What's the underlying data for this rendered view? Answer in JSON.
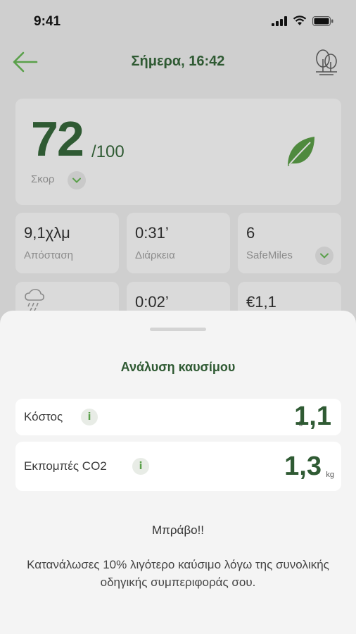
{
  "status_bar": {
    "time": "9:41"
  },
  "header": {
    "title": "Σήμερα, 16:42"
  },
  "score": {
    "value": "72",
    "total": "/100",
    "label": "Σκορ"
  },
  "stats": [
    {
      "value": "9,1χλμ",
      "label": "Απόσταση"
    },
    {
      "value": "0:31’",
      "label": "Διάρκεια"
    },
    {
      "value": "6",
      "label": "SafeMiles"
    },
    {
      "value": "0:02’"
    },
    {
      "value": "€1,1"
    }
  ],
  "sheet": {
    "title": "Ανάλυση καυσίμου",
    "rows": [
      {
        "label": "Κόστος",
        "prefix": "€",
        "value": "1,1"
      },
      {
        "label": "Εκπομπές CO2",
        "value": "1,3",
        "unit": "kg"
      }
    ],
    "bravo": "Μπράβο!!",
    "description": "Κατανάλωσες 10% λιγότερο καύσιμο λόγω της συνολικής οδηγικής συμπεριφοράς σου."
  },
  "colors": {
    "accent": "#2f5a33",
    "icon_green": "#5aa04a",
    "overlay": "#cfcfcf",
    "sheet": "#f4f4f4"
  }
}
